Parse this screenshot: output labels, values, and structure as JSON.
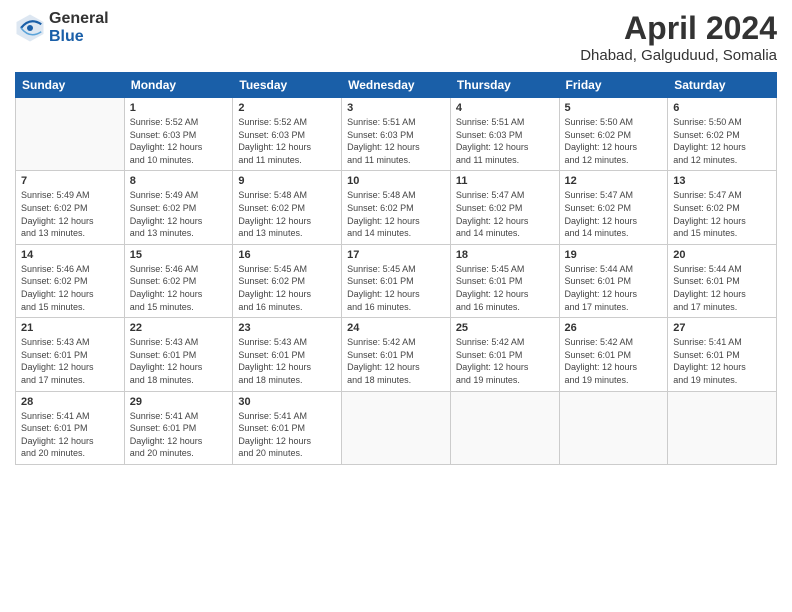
{
  "header": {
    "logo_general": "General",
    "logo_blue": "Blue",
    "title": "April 2024",
    "subtitle": "Dhabad, Galguduud, Somalia"
  },
  "calendar": {
    "days_of_week": [
      "Sunday",
      "Monday",
      "Tuesday",
      "Wednesday",
      "Thursday",
      "Friday",
      "Saturday"
    ],
    "weeks": [
      [
        {
          "day": "",
          "info": ""
        },
        {
          "day": "1",
          "info": "Sunrise: 5:52 AM\nSunset: 6:03 PM\nDaylight: 12 hours\nand 10 minutes."
        },
        {
          "day": "2",
          "info": "Sunrise: 5:52 AM\nSunset: 6:03 PM\nDaylight: 12 hours\nand 11 minutes."
        },
        {
          "day": "3",
          "info": "Sunrise: 5:51 AM\nSunset: 6:03 PM\nDaylight: 12 hours\nand 11 minutes."
        },
        {
          "day": "4",
          "info": "Sunrise: 5:51 AM\nSunset: 6:03 PM\nDaylight: 12 hours\nand 11 minutes."
        },
        {
          "day": "5",
          "info": "Sunrise: 5:50 AM\nSunset: 6:02 PM\nDaylight: 12 hours\nand 12 minutes."
        },
        {
          "day": "6",
          "info": "Sunrise: 5:50 AM\nSunset: 6:02 PM\nDaylight: 12 hours\nand 12 minutes."
        }
      ],
      [
        {
          "day": "7",
          "info": "Sunrise: 5:49 AM\nSunset: 6:02 PM\nDaylight: 12 hours\nand 13 minutes."
        },
        {
          "day": "8",
          "info": "Sunrise: 5:49 AM\nSunset: 6:02 PM\nDaylight: 12 hours\nand 13 minutes."
        },
        {
          "day": "9",
          "info": "Sunrise: 5:48 AM\nSunset: 6:02 PM\nDaylight: 12 hours\nand 13 minutes."
        },
        {
          "day": "10",
          "info": "Sunrise: 5:48 AM\nSunset: 6:02 PM\nDaylight: 12 hours\nand 14 minutes."
        },
        {
          "day": "11",
          "info": "Sunrise: 5:47 AM\nSunset: 6:02 PM\nDaylight: 12 hours\nand 14 minutes."
        },
        {
          "day": "12",
          "info": "Sunrise: 5:47 AM\nSunset: 6:02 PM\nDaylight: 12 hours\nand 14 minutes."
        },
        {
          "day": "13",
          "info": "Sunrise: 5:47 AM\nSunset: 6:02 PM\nDaylight: 12 hours\nand 15 minutes."
        }
      ],
      [
        {
          "day": "14",
          "info": "Sunrise: 5:46 AM\nSunset: 6:02 PM\nDaylight: 12 hours\nand 15 minutes."
        },
        {
          "day": "15",
          "info": "Sunrise: 5:46 AM\nSunset: 6:02 PM\nDaylight: 12 hours\nand 15 minutes."
        },
        {
          "day": "16",
          "info": "Sunrise: 5:45 AM\nSunset: 6:02 PM\nDaylight: 12 hours\nand 16 minutes."
        },
        {
          "day": "17",
          "info": "Sunrise: 5:45 AM\nSunset: 6:01 PM\nDaylight: 12 hours\nand 16 minutes."
        },
        {
          "day": "18",
          "info": "Sunrise: 5:45 AM\nSunset: 6:01 PM\nDaylight: 12 hours\nand 16 minutes."
        },
        {
          "day": "19",
          "info": "Sunrise: 5:44 AM\nSunset: 6:01 PM\nDaylight: 12 hours\nand 17 minutes."
        },
        {
          "day": "20",
          "info": "Sunrise: 5:44 AM\nSunset: 6:01 PM\nDaylight: 12 hours\nand 17 minutes."
        }
      ],
      [
        {
          "day": "21",
          "info": "Sunrise: 5:43 AM\nSunset: 6:01 PM\nDaylight: 12 hours\nand 17 minutes."
        },
        {
          "day": "22",
          "info": "Sunrise: 5:43 AM\nSunset: 6:01 PM\nDaylight: 12 hours\nand 18 minutes."
        },
        {
          "day": "23",
          "info": "Sunrise: 5:43 AM\nSunset: 6:01 PM\nDaylight: 12 hours\nand 18 minutes."
        },
        {
          "day": "24",
          "info": "Sunrise: 5:42 AM\nSunset: 6:01 PM\nDaylight: 12 hours\nand 18 minutes."
        },
        {
          "day": "25",
          "info": "Sunrise: 5:42 AM\nSunset: 6:01 PM\nDaylight: 12 hours\nand 19 minutes."
        },
        {
          "day": "26",
          "info": "Sunrise: 5:42 AM\nSunset: 6:01 PM\nDaylight: 12 hours\nand 19 minutes."
        },
        {
          "day": "27",
          "info": "Sunrise: 5:41 AM\nSunset: 6:01 PM\nDaylight: 12 hours\nand 19 minutes."
        }
      ],
      [
        {
          "day": "28",
          "info": "Sunrise: 5:41 AM\nSunset: 6:01 PM\nDaylight: 12 hours\nand 20 minutes."
        },
        {
          "day": "29",
          "info": "Sunrise: 5:41 AM\nSunset: 6:01 PM\nDaylight: 12 hours\nand 20 minutes."
        },
        {
          "day": "30",
          "info": "Sunrise: 5:41 AM\nSunset: 6:01 PM\nDaylight: 12 hours\nand 20 minutes."
        },
        {
          "day": "",
          "info": ""
        },
        {
          "day": "",
          "info": ""
        },
        {
          "day": "",
          "info": ""
        },
        {
          "day": "",
          "info": ""
        }
      ]
    ]
  }
}
